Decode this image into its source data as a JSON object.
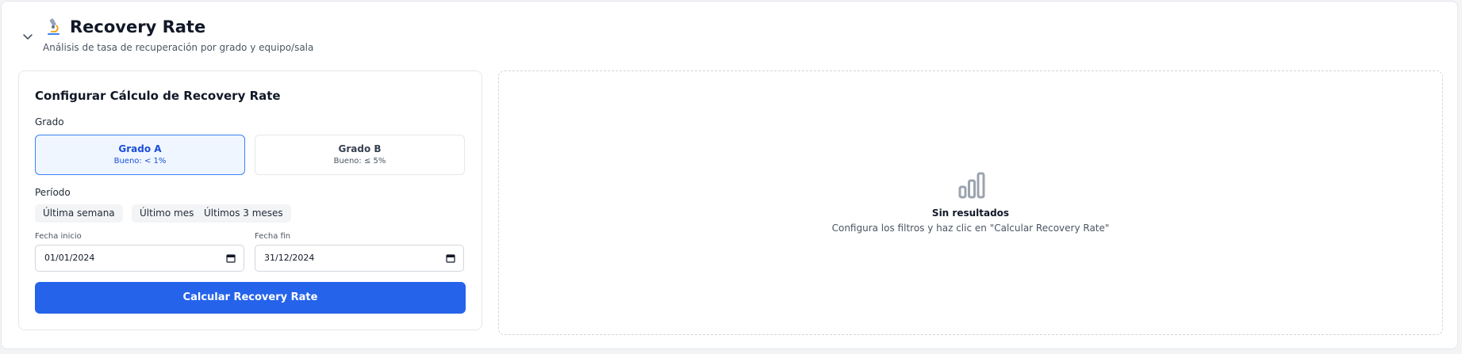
{
  "header": {
    "title": "Recovery Rate",
    "subtitle": "Análisis de tasa de recuperación por grado y equipo/sala",
    "icon": "microscope-icon",
    "collapse_icon": "chevron-down-icon"
  },
  "config": {
    "title": "Configurar Cálculo de Recovery Rate",
    "grade_label": "Grado",
    "grades": [
      {
        "name": "Grado A",
        "note": "Bueno: < 1%",
        "selected": true
      },
      {
        "name": "Grado B",
        "note": "Bueno: ≤ 5%",
        "selected": false
      }
    ],
    "period_label": "Período",
    "periods": [
      "Última semana",
      "Último mes",
      "Últimos 3 meses"
    ],
    "start_label": "Fecha inicio",
    "start_value": "01/01/2024",
    "end_label": "Fecha fin",
    "end_value": "31/12/2024",
    "calculate_label": "Calcular Recovery Rate"
  },
  "results": {
    "empty_title": "Sin resultados",
    "empty_message": "Configura los filtros y haz clic en \"Calcular Recovery Rate\"",
    "icon": "bar-chart-icon"
  },
  "colors": {
    "accent": "#2563eb",
    "selected_bg": "#eff6ff",
    "selected_border": "#3b82f6"
  }
}
